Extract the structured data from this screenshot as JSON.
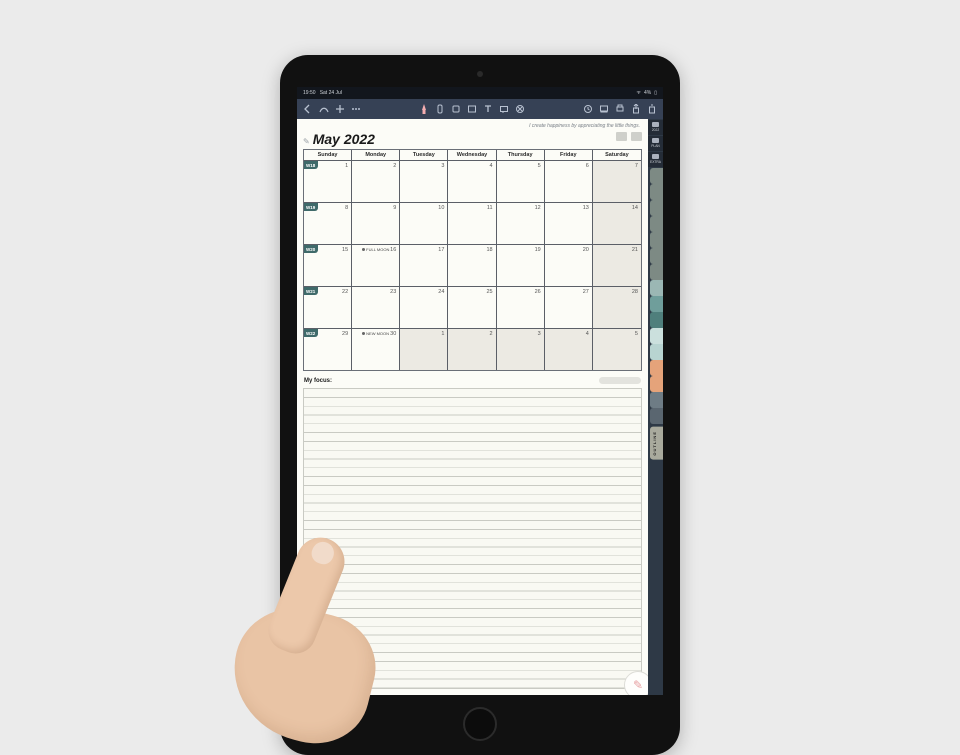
{
  "status": {
    "time": "19:50",
    "date": "Sat 24 Jul",
    "battery": "4%"
  },
  "toolbar_icons": [
    "back",
    "draw",
    "add",
    "more",
    "pen",
    "highlighter",
    "eraser",
    "rect",
    "text",
    "lasso",
    "erase-all",
    "clock",
    "view",
    "print",
    "share",
    "trash"
  ],
  "quote": "I create happiness by appreciating the little things.",
  "page_title": "May 2022",
  "focus_label": "My focus:",
  "day_headers": [
    "Sunday",
    "Monday",
    "Tuesday",
    "Wednesday",
    "Thursday",
    "Friday",
    "Saturday"
  ],
  "weeks": [
    {
      "wk": "W18",
      "days": [
        1,
        2,
        3,
        4,
        5,
        6,
        7
      ],
      "shade_last": true,
      "event": null
    },
    {
      "wk": "W19",
      "days": [
        8,
        9,
        10,
        11,
        12,
        13,
        14
      ],
      "shade_last": true,
      "event": null
    },
    {
      "wk": "W20",
      "days": [
        15,
        16,
        17,
        18,
        19,
        20,
        21
      ],
      "shade_last": true,
      "event": {
        "col": 1,
        "label": "FULL MOON"
      }
    },
    {
      "wk": "W21",
      "days": [
        22,
        23,
        24,
        25,
        26,
        27,
        28
      ],
      "shade_last": true,
      "event": null
    },
    {
      "wk": "W22",
      "days": [
        29,
        30,
        1,
        2,
        3,
        4,
        5
      ],
      "shade_from": 2,
      "event": {
        "col": 1,
        "label": "NEW MOON"
      }
    }
  ],
  "rail_top": [
    {
      "label": "2022"
    },
    {
      "label": "PLAN"
    },
    {
      "label": "EXTRA"
    }
  ],
  "rail_tabs": [
    "#7d8a84",
    "#7d8a84",
    "#7d8a84",
    "#7d8a84",
    "#7d8a84",
    "#7d8a84",
    "#7d8a84",
    "#9bb7b4",
    "#6f9e9b",
    "#4f7f7c",
    "#cbe0dd",
    "#b8d4d1",
    "#e5a37a",
    "#e5a37a",
    "#6e7c85",
    "#5a6670"
  ],
  "outline_label": "OUTLINE"
}
